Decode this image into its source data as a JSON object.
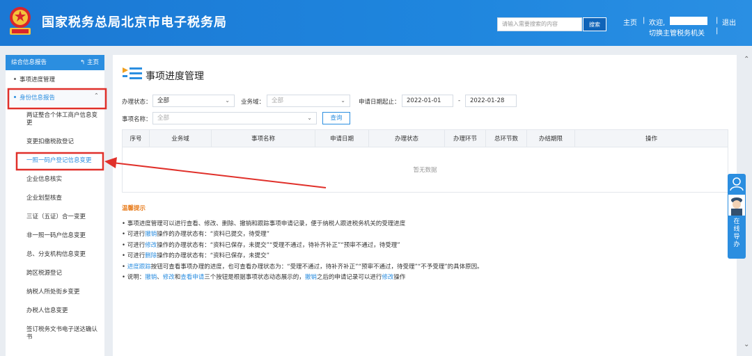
{
  "header": {
    "title": "国家税务总局北京市电子税务局",
    "search_placeholder": "请输入需要搜索的内容",
    "search_button": "搜索",
    "home_link": "主页",
    "welcome": "欢迎,",
    "switch_office": "切换主管税务机关",
    "logout": "退出",
    "separator": "|"
  },
  "sidebar": {
    "section_title": "综合信息报告",
    "home_label": "主页",
    "items": [
      {
        "label": "事项进度管理"
      },
      {
        "label": "身份信息报告"
      }
    ],
    "sub_items": [
      {
        "label": "两证整合个体工商户信息变更"
      },
      {
        "label": "变更扣缴税款登记"
      },
      {
        "label": "一照一码户登记信息变更"
      },
      {
        "label": "企业信息核实"
      },
      {
        "label": "企业划型核查"
      },
      {
        "label": "三证（五证）合一变更"
      },
      {
        "label": "非一照一码户信息变更"
      },
      {
        "label": "总、分支机构信息变更"
      },
      {
        "label": "跨区税源登记"
      },
      {
        "label": "纳税人所处街乡变更"
      },
      {
        "label": "办税人信息变更"
      },
      {
        "label": "签订税务文书电子送达确认书"
      }
    ]
  },
  "main": {
    "title": "事项进度管理",
    "filters": {
      "status_label": "办理状态：",
      "status_value": "全部",
      "domain_label": "业务域：",
      "domain_placeholder": "全部",
      "date_label": "申请日期起止：",
      "date_from": "2022-01-01",
      "date_sep": "-",
      "date_to": "2022-01-28",
      "name_label": "事项名称：",
      "name_placeholder": "全部",
      "query_button": "查询"
    },
    "table": {
      "columns": [
        "序号",
        "业务域",
        "事项名称",
        "申请日期",
        "办理状态",
        "办理环节",
        "总环节数",
        "办结期限",
        "操作"
      ],
      "empty_text": "暂无数据"
    },
    "tips": {
      "title": "温馨提示",
      "line1": "• 事项进度管理可以进行查看、修改、删除、撤销和跟踪事项申请记录，便于纳税人跟进税务机关的受理进度",
      "line2_pre": "• 可进行",
      "line2_kw": "撤销",
      "line2_post": "操作的办理状态有：“资料已提交，待受理”",
      "line3_pre": "• 可进行",
      "line3_kw": "修改",
      "line3_post": "操作的办理状态有：“资料已保存，未提交”“受理不通过，待补齐补正”“预审不通过，待受理”",
      "line4_pre": "• 可进行",
      "line4_kw": "删除",
      "line4_post": "操作的办理状态有：“资料已保存，未提交”",
      "line5_pre": "• ",
      "line5_kw": "进度跟踪",
      "line5_post": "按钮可查看事项办理的进度，也可查看办理状态为：“受理不通过，待补齐补正”“预审不通过，待受理”“不予受理”的具体原因。",
      "line6_pre": "• 说明：",
      "line6_kw1": "撤销",
      "line6_sep1": "、",
      "line6_kw2": "修改",
      "line6_mid": "和",
      "line6_kw3": "查看申请",
      "line6_mid2": "三个按钮是根据事项状态动态展示的，",
      "line6_kw4": "撤销",
      "line6_mid3": "之后的申请记录可以进行",
      "line6_kw5": "修改",
      "line6_end": "操作"
    }
  },
  "side_widget": {
    "text": "在线导办"
  },
  "colors": {
    "header_blue": "#1f86de",
    "accent_blue": "#2b8ee0",
    "highlight_red": "#e0302a",
    "tips_orange": "#e87c1c"
  }
}
